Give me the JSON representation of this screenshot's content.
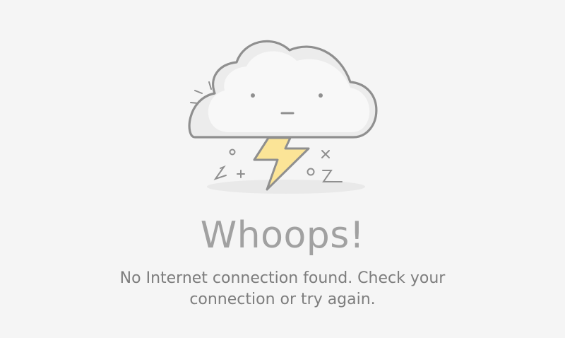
{
  "error_screen": {
    "illustration": {
      "cloud_icon": "sad-cloud-icon",
      "lightning_icon": "lightning-bolt-icon",
      "lightning_color": "#fbe497"
    },
    "title": "Whoops!",
    "message": "No Internet connection found. Check your connection or try again."
  }
}
